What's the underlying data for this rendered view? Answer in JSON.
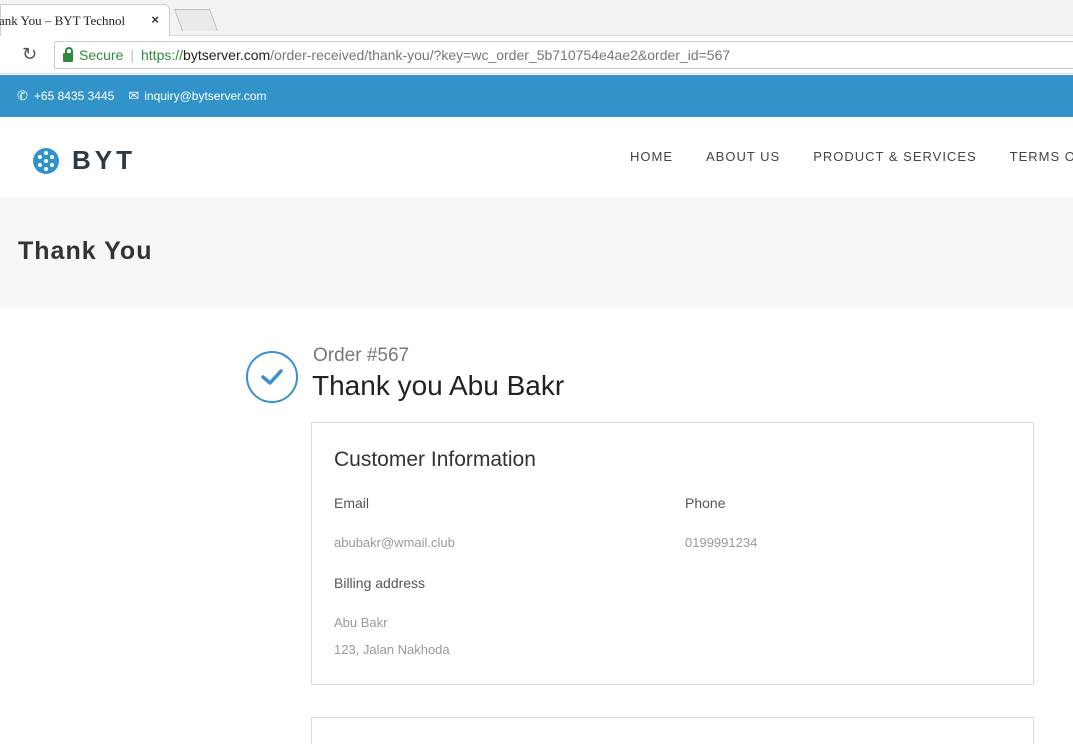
{
  "browser": {
    "tab_title": "ank You – BYT Technol",
    "tab_close": "×",
    "secure_label": "Secure",
    "url_proto": "https://",
    "url_host": "bytserver.com",
    "url_path": "/order-received/thank-you/?key=wc_order_5b710754e4ae2&order_id=567"
  },
  "topbar": {
    "phone": "+65 8435 3445",
    "email": "inquiry@bytserver.com"
  },
  "header": {
    "logo_text": "BYT",
    "nav": [
      "HOME",
      "ABOUT US",
      "PRODUCT & SERVICES",
      "TERMS OF"
    ]
  },
  "page": {
    "title": "Thank You",
    "order_number": "Order #567",
    "thank_you": "Thank you Abu Bakr"
  },
  "customer": {
    "heading": "Customer Information",
    "email_label": "Email",
    "email_value": "abubakr@wmail.club",
    "phone_label": "Phone",
    "phone_value": "0199991234",
    "billing_label": "Billing address",
    "billing_name": "Abu Bakr",
    "billing_street": "123, Jalan Nakhoda"
  },
  "colors": {
    "topbar": "#3193c8",
    "accent": "#3b8fd0",
    "secure": "#2e8b3d"
  }
}
